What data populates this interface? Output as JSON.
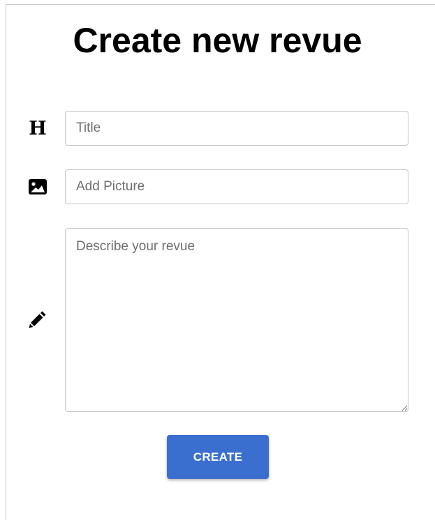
{
  "page": {
    "title": "Create new revue"
  },
  "form": {
    "title_field": {
      "icon": "heading-icon",
      "icon_glyph": "H",
      "placeholder": "Title",
      "value": ""
    },
    "picture_field": {
      "icon": "image-icon",
      "placeholder": "Add Picture",
      "value": ""
    },
    "description_field": {
      "icon": "pencil-icon",
      "placeholder": "Describe your revue",
      "value": ""
    },
    "submit": {
      "label": "CREATE"
    }
  },
  "colors": {
    "button_bg": "#3a6fd0",
    "button_text": "#ffffff",
    "field_border": "#c4c4c4"
  }
}
